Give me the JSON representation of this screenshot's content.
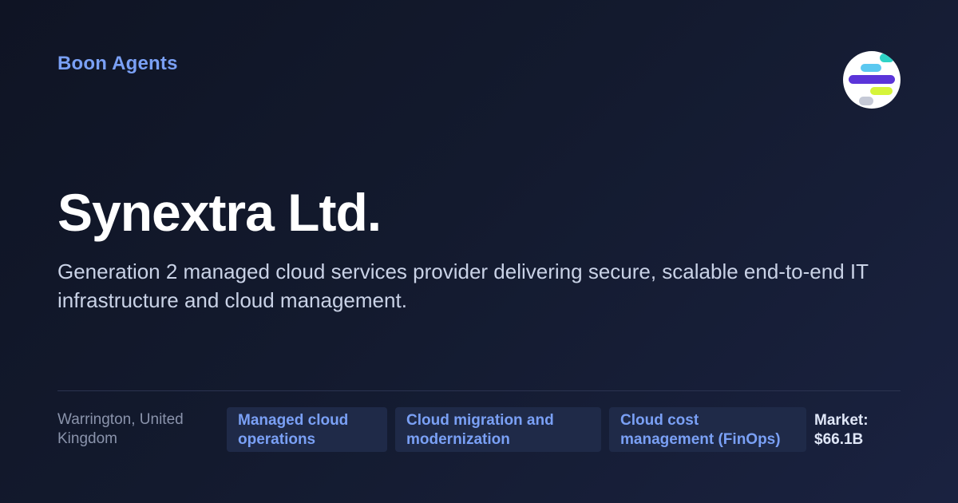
{
  "brand": {
    "name": "Boon Agents",
    "logo_icon": "boon-agents-logo-icon",
    "logo_colors": [
      "#2ed3c6",
      "#5bc8f0",
      "#5b34d9",
      "#d6f53a",
      "#c5c9d6"
    ]
  },
  "company": {
    "name": "Synextra Ltd.",
    "description": "Generation 2 managed cloud services provider delivering secure, scalable end-to-end IT infrastructure and cloud management."
  },
  "footer": {
    "location": "Warrington, United Kingdom",
    "tags": [
      "Managed cloud operations",
      "Cloud migration and modernization",
      "Cloud cost management (FinOps)"
    ],
    "market": "Market: $66.1B"
  },
  "colors": {
    "background": "#131a2e",
    "accent": "#7aa0f5",
    "tag_background": "#1f2a48",
    "text_primary": "#ffffff",
    "text_secondary": "#c9d2e6",
    "text_muted": "#8a93ab"
  }
}
